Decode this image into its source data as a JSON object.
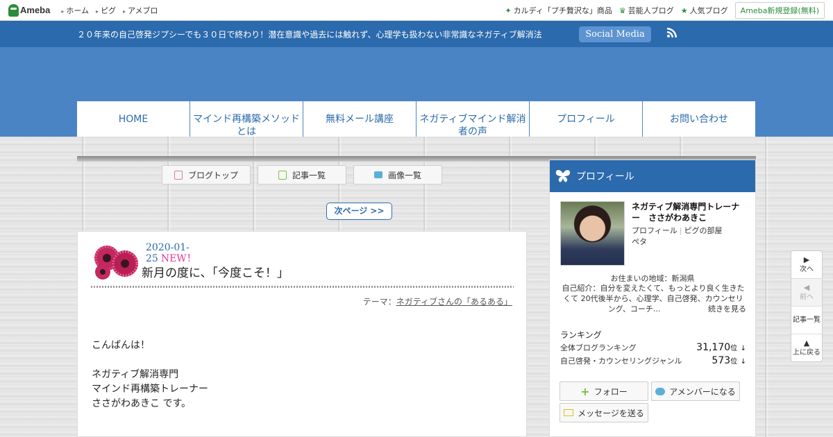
{
  "ameba": {
    "logo": "Ameba",
    "nav": [
      "ホーム",
      "ピグ",
      "アメブロ"
    ],
    "right_links": [
      {
        "icon": "sparkle-icon",
        "label": "カルディ「プチ贅沢な」商品"
      },
      {
        "icon": "crown-icon",
        "label": "芸能人ブログ"
      },
      {
        "icon": "star-icon",
        "label": "人気ブログ"
      }
    ],
    "register": "Ameba新規登録(無料)"
  },
  "header": {
    "tagline": "２０年来の自己啓発ジプシーでも３０日で終わり！潜在意識や過去には触れず、心理学も扱わない非常識なネガティブ解消法",
    "social": "Social Media",
    "accent": "#2b6aad",
    "bg": "#4a84c4"
  },
  "gnav": [
    "HOME",
    "マインド再構築メソッドとは",
    "無料メール講座",
    "ネガティブマインド解消者の声",
    "プロフィール",
    "お問い合わせ"
  ],
  "blog_buttons": [
    "ブログトップ",
    "記事一覧",
    "画像一覧"
  ],
  "next_page": "次ページ >>",
  "article": {
    "date": "2020-01-25",
    "new_label": "NEW！",
    "title": "新月の度に、「今度こそ！」",
    "theme_label": "テーマ：",
    "theme_link": "ネガティブさんの「あるある」",
    "paragraphs": [
      [
        "こんばんは！"
      ],
      [
        "ネガティブ解消専門",
        "マインド再構築トレーナー",
        "ささがわあきこ です。"
      ]
    ]
  },
  "sidebar": {
    "title": "プロフィール",
    "name": "ネガティブ解消専門トレーナー　ささがわあきこ",
    "links": [
      "プロフィール",
      "ピグの部屋",
      "ペタ"
    ],
    "region": "お住まいの地域：新潟県",
    "intro": "自己紹介：自分を変えたくて、もっとより良く生きたくて 20代後半から、心理学、自己啓発、カウンセリング、コーチ...",
    "more": "続きを見る",
    "ranking_title": "ランキング",
    "rankings": [
      {
        "label": "全体ブログランキング",
        "value": "31,170",
        "unit": "位",
        "trend": "↓"
      },
      {
        "label": "自己啓発・カウンセリングジャンル",
        "value": "573",
        "unit": "位",
        "trend": "↓"
      }
    ],
    "follow": "フォロー",
    "amember": "アメンバーになる",
    "message": "メッセージを送る"
  },
  "floatnav": {
    "next": "次へ",
    "prev": "前へ",
    "list": "記事一覧",
    "top": "上に戻る"
  }
}
